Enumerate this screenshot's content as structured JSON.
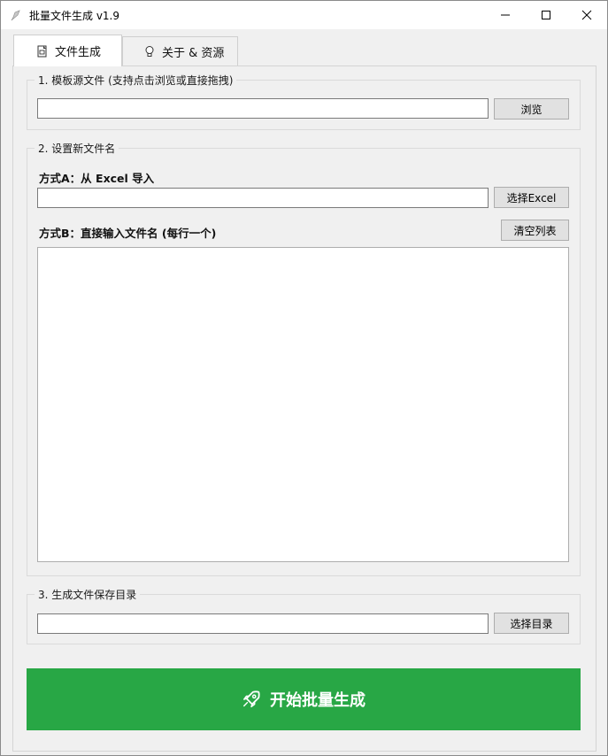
{
  "window": {
    "title": "批量文件生成 v1.9",
    "controls": {
      "minimize": "—",
      "maximize": "☐",
      "close": "✕"
    }
  },
  "tabs": [
    {
      "label": "文件生成",
      "icon": "document-icon",
      "active": true
    },
    {
      "label": "关于 & 资源",
      "icon": "lightbulb-icon",
      "active": false
    }
  ],
  "section1": {
    "title": "1. 模板源文件 (支持点击浏览或直接拖拽)",
    "input_value": "",
    "browse_label": "浏览"
  },
  "section2": {
    "title": "2. 设置新文件名",
    "method_a_label": "方式A：从 Excel 导入",
    "excel_input_value": "",
    "select_excel_label": "选择Excel",
    "method_b_label": "方式B：直接输入文件名 (每行一个)",
    "clear_list_label": "清空列表",
    "names_text": ""
  },
  "section3": {
    "title": "3. 生成文件保存目录",
    "dir_input_value": "",
    "select_dir_label": "选择目录"
  },
  "start": {
    "label": "开始批量生成",
    "icon": "rocket-icon",
    "color": "#28a745"
  }
}
